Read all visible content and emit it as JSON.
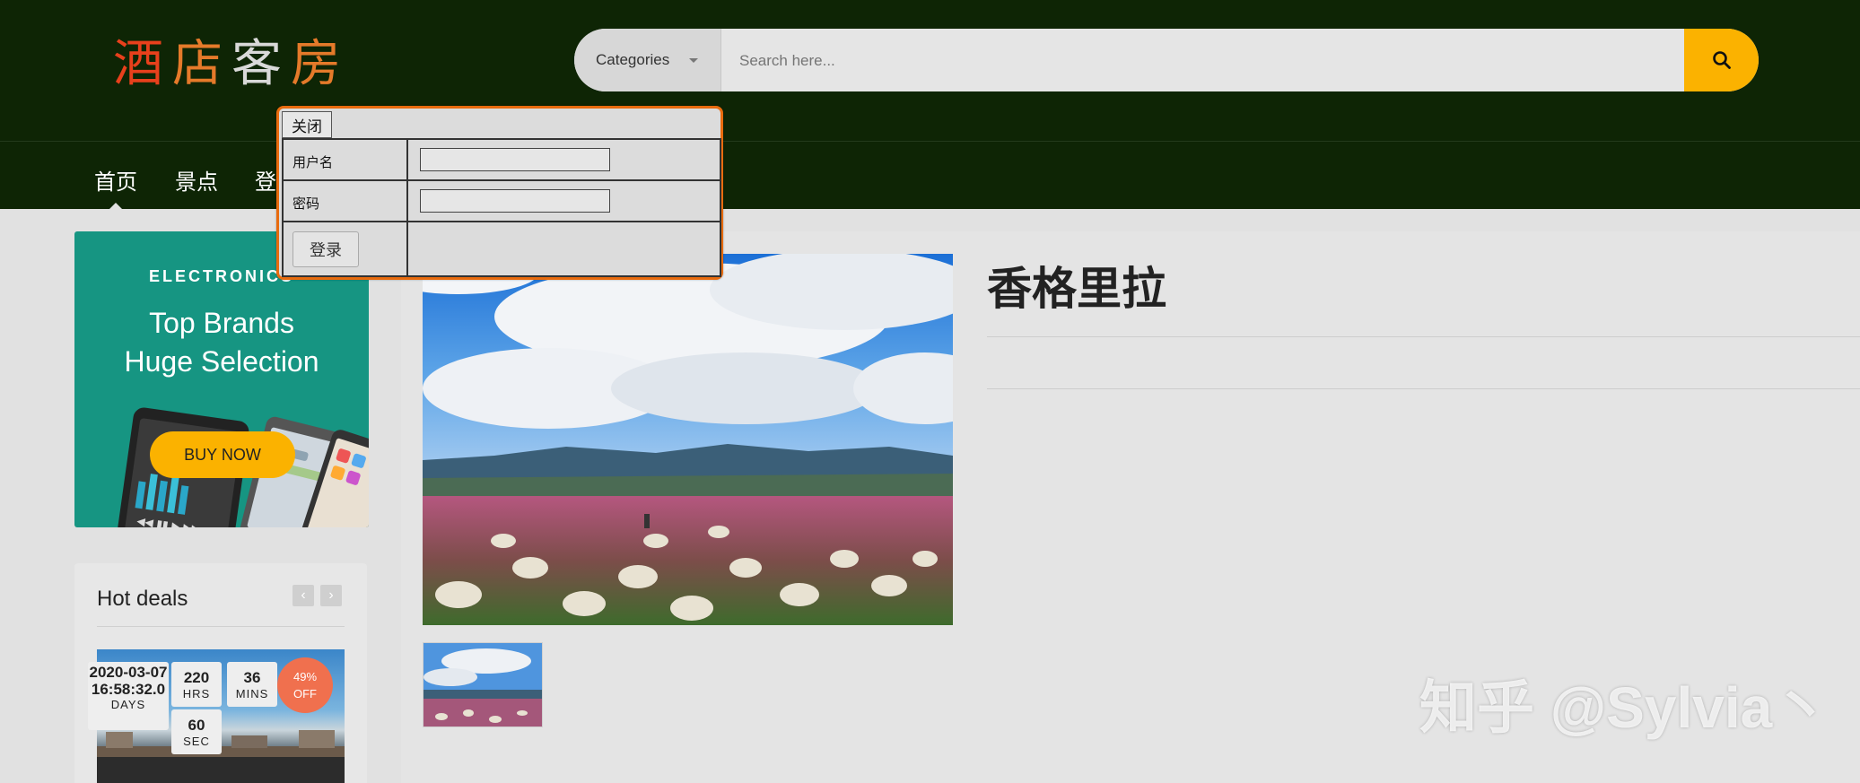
{
  "header": {
    "logo_chars": [
      "酒",
      "店",
      "客",
      "房"
    ],
    "search": {
      "category_label": "Categories",
      "placeholder": "Search here..."
    }
  },
  "nav": {
    "items": [
      {
        "label": "首页"
      },
      {
        "label": "景点"
      },
      {
        "label": "登"
      }
    ]
  },
  "sidebar": {
    "promo": {
      "category": "ELECTRONICS",
      "title_line1": "Top Brands",
      "title_line2": "Huge Selection",
      "button": "BUY NOW"
    },
    "hot_deals": {
      "title": "Hot deals",
      "prev": "‹",
      "next": "›",
      "badge_line1": "49%",
      "badge_line2": "OFF",
      "timer": {
        "days_value": "2020-03-07 16:58:32.0",
        "days_unit": "DAYS",
        "hrs_value": "220",
        "hrs_unit": "HRS",
        "mins_value": "36",
        "mins_unit": "MINS",
        "sec_value": "60",
        "sec_unit": "SEC"
      }
    }
  },
  "product": {
    "title": "香格里拉"
  },
  "login_popup": {
    "close_label": "关闭",
    "username_label": "用户名",
    "username_value": "",
    "password_label": "密码",
    "password_value": "",
    "login_button": "登录"
  },
  "watermark": "知乎 @Sylvia丶",
  "colors": {
    "header_bg": "#0e2505",
    "accent": "#fbb200",
    "promo_bg": "#169582",
    "popup_border": "#e86b0e"
  }
}
